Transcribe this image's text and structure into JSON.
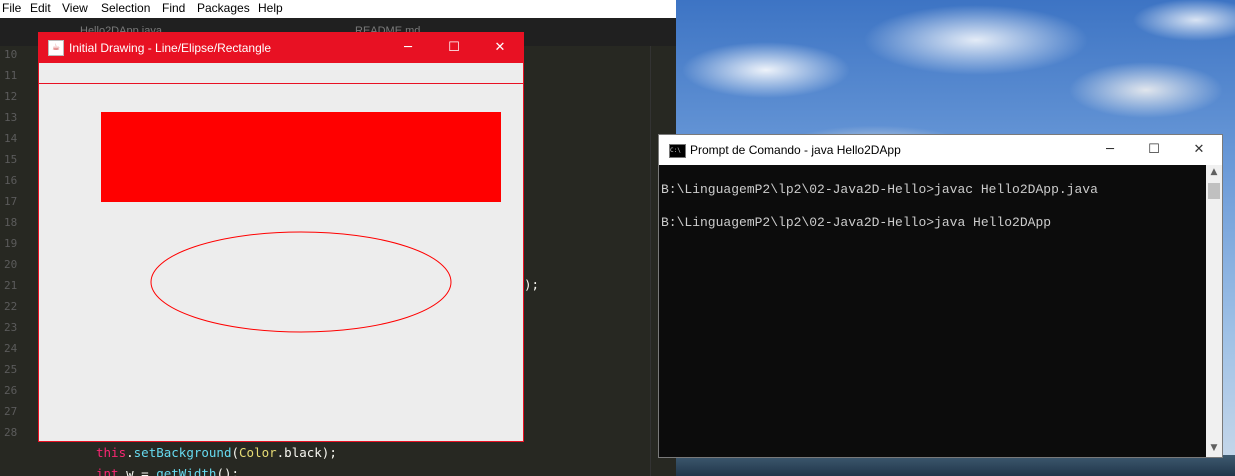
{
  "editor": {
    "menu": [
      "File",
      "Edit",
      "View",
      "Selection",
      "Find",
      "Packages",
      "Help"
    ],
    "tabs": [
      "Hello2DApp.java",
      "README.md"
    ],
    "line_numbers": [
      "10",
      "11",
      "12",
      "13",
      "14",
      "15",
      "16",
      "17",
      "18",
      "19",
      "20",
      "21",
      "22",
      "23",
      "24",
      "25",
      "26",
      "27",
      "28"
    ],
    "code_lines": {
      "line27_a": "this",
      "line27_b": ".",
      "line27_c": "setBackground",
      "line27_d": "(",
      "line27_e": "Color",
      "line27_f": ".black);",
      "line28_a": "int",
      "line28_b": " w = ",
      "line28_c": "getWidth",
      "line28_d": "();",
      "line21_tail": ");"
    }
  },
  "java_window": {
    "title": "Initial Drawing - Line/Elipse/Rectangle",
    "minimize": "─",
    "maximize": "☐",
    "close": "✕",
    "shapes": {
      "stroke_color": "#ff0000",
      "fill_color": "#ff0000"
    }
  },
  "cmd_window": {
    "title": "Prompt de Comando - java  Hello2DApp",
    "icon_text": "C:\\",
    "minimize": "─",
    "maximize": "☐",
    "close": "✕",
    "lines": [
      "B:\\LinguagemP2\\lp2\\02-Java2D-Hello>javac Hello2DApp.java",
      "B:\\LinguagemP2\\lp2\\02-Java2D-Hello>java Hello2DApp"
    ]
  }
}
